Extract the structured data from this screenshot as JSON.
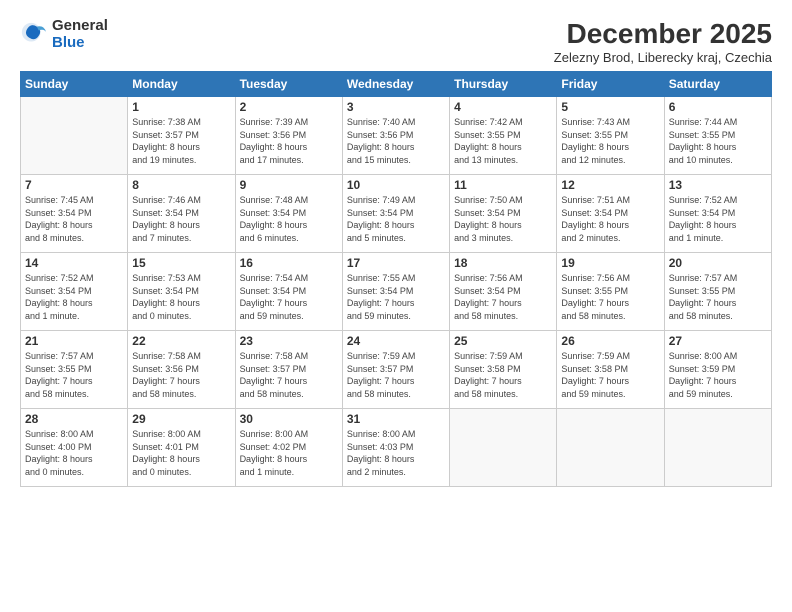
{
  "logo": {
    "general": "General",
    "blue": "Blue"
  },
  "header": {
    "title": "December 2025",
    "location": "Zelezny Brod, Liberecky kraj, Czechia"
  },
  "weekdays": [
    "Sunday",
    "Monday",
    "Tuesday",
    "Wednesday",
    "Thursday",
    "Friday",
    "Saturday"
  ],
  "weeks": [
    [
      {
        "day": "",
        "info": ""
      },
      {
        "day": "1",
        "info": "Sunrise: 7:38 AM\nSunset: 3:57 PM\nDaylight: 8 hours\nand 19 minutes."
      },
      {
        "day": "2",
        "info": "Sunrise: 7:39 AM\nSunset: 3:56 PM\nDaylight: 8 hours\nand 17 minutes."
      },
      {
        "day": "3",
        "info": "Sunrise: 7:40 AM\nSunset: 3:56 PM\nDaylight: 8 hours\nand 15 minutes."
      },
      {
        "day": "4",
        "info": "Sunrise: 7:42 AM\nSunset: 3:55 PM\nDaylight: 8 hours\nand 13 minutes."
      },
      {
        "day": "5",
        "info": "Sunrise: 7:43 AM\nSunset: 3:55 PM\nDaylight: 8 hours\nand 12 minutes."
      },
      {
        "day": "6",
        "info": "Sunrise: 7:44 AM\nSunset: 3:55 PM\nDaylight: 8 hours\nand 10 minutes."
      }
    ],
    [
      {
        "day": "7",
        "info": "Sunrise: 7:45 AM\nSunset: 3:54 PM\nDaylight: 8 hours\nand 8 minutes."
      },
      {
        "day": "8",
        "info": "Sunrise: 7:46 AM\nSunset: 3:54 PM\nDaylight: 8 hours\nand 7 minutes."
      },
      {
        "day": "9",
        "info": "Sunrise: 7:48 AM\nSunset: 3:54 PM\nDaylight: 8 hours\nand 6 minutes."
      },
      {
        "day": "10",
        "info": "Sunrise: 7:49 AM\nSunset: 3:54 PM\nDaylight: 8 hours\nand 5 minutes."
      },
      {
        "day": "11",
        "info": "Sunrise: 7:50 AM\nSunset: 3:54 PM\nDaylight: 8 hours\nand 3 minutes."
      },
      {
        "day": "12",
        "info": "Sunrise: 7:51 AM\nSunset: 3:54 PM\nDaylight: 8 hours\nand 2 minutes."
      },
      {
        "day": "13",
        "info": "Sunrise: 7:52 AM\nSunset: 3:54 PM\nDaylight: 8 hours\nand 1 minute."
      }
    ],
    [
      {
        "day": "14",
        "info": "Sunrise: 7:52 AM\nSunset: 3:54 PM\nDaylight: 8 hours\nand 1 minute."
      },
      {
        "day": "15",
        "info": "Sunrise: 7:53 AM\nSunset: 3:54 PM\nDaylight: 8 hours\nand 0 minutes."
      },
      {
        "day": "16",
        "info": "Sunrise: 7:54 AM\nSunset: 3:54 PM\nDaylight: 7 hours\nand 59 minutes."
      },
      {
        "day": "17",
        "info": "Sunrise: 7:55 AM\nSunset: 3:54 PM\nDaylight: 7 hours\nand 59 minutes."
      },
      {
        "day": "18",
        "info": "Sunrise: 7:56 AM\nSunset: 3:54 PM\nDaylight: 7 hours\nand 58 minutes."
      },
      {
        "day": "19",
        "info": "Sunrise: 7:56 AM\nSunset: 3:55 PM\nDaylight: 7 hours\nand 58 minutes."
      },
      {
        "day": "20",
        "info": "Sunrise: 7:57 AM\nSunset: 3:55 PM\nDaylight: 7 hours\nand 58 minutes."
      }
    ],
    [
      {
        "day": "21",
        "info": "Sunrise: 7:57 AM\nSunset: 3:55 PM\nDaylight: 7 hours\nand 58 minutes."
      },
      {
        "day": "22",
        "info": "Sunrise: 7:58 AM\nSunset: 3:56 PM\nDaylight: 7 hours\nand 58 minutes."
      },
      {
        "day": "23",
        "info": "Sunrise: 7:58 AM\nSunset: 3:57 PM\nDaylight: 7 hours\nand 58 minutes."
      },
      {
        "day": "24",
        "info": "Sunrise: 7:59 AM\nSunset: 3:57 PM\nDaylight: 7 hours\nand 58 minutes."
      },
      {
        "day": "25",
        "info": "Sunrise: 7:59 AM\nSunset: 3:58 PM\nDaylight: 7 hours\nand 58 minutes."
      },
      {
        "day": "26",
        "info": "Sunrise: 7:59 AM\nSunset: 3:58 PM\nDaylight: 7 hours\nand 59 minutes."
      },
      {
        "day": "27",
        "info": "Sunrise: 8:00 AM\nSunset: 3:59 PM\nDaylight: 7 hours\nand 59 minutes."
      }
    ],
    [
      {
        "day": "28",
        "info": "Sunrise: 8:00 AM\nSunset: 4:00 PM\nDaylight: 8 hours\nand 0 minutes."
      },
      {
        "day": "29",
        "info": "Sunrise: 8:00 AM\nSunset: 4:01 PM\nDaylight: 8 hours\nand 0 minutes."
      },
      {
        "day": "30",
        "info": "Sunrise: 8:00 AM\nSunset: 4:02 PM\nDaylight: 8 hours\nand 1 minute."
      },
      {
        "day": "31",
        "info": "Sunrise: 8:00 AM\nSunset: 4:03 PM\nDaylight: 8 hours\nand 2 minutes."
      },
      {
        "day": "",
        "info": ""
      },
      {
        "day": "",
        "info": ""
      },
      {
        "day": "",
        "info": ""
      }
    ]
  ]
}
